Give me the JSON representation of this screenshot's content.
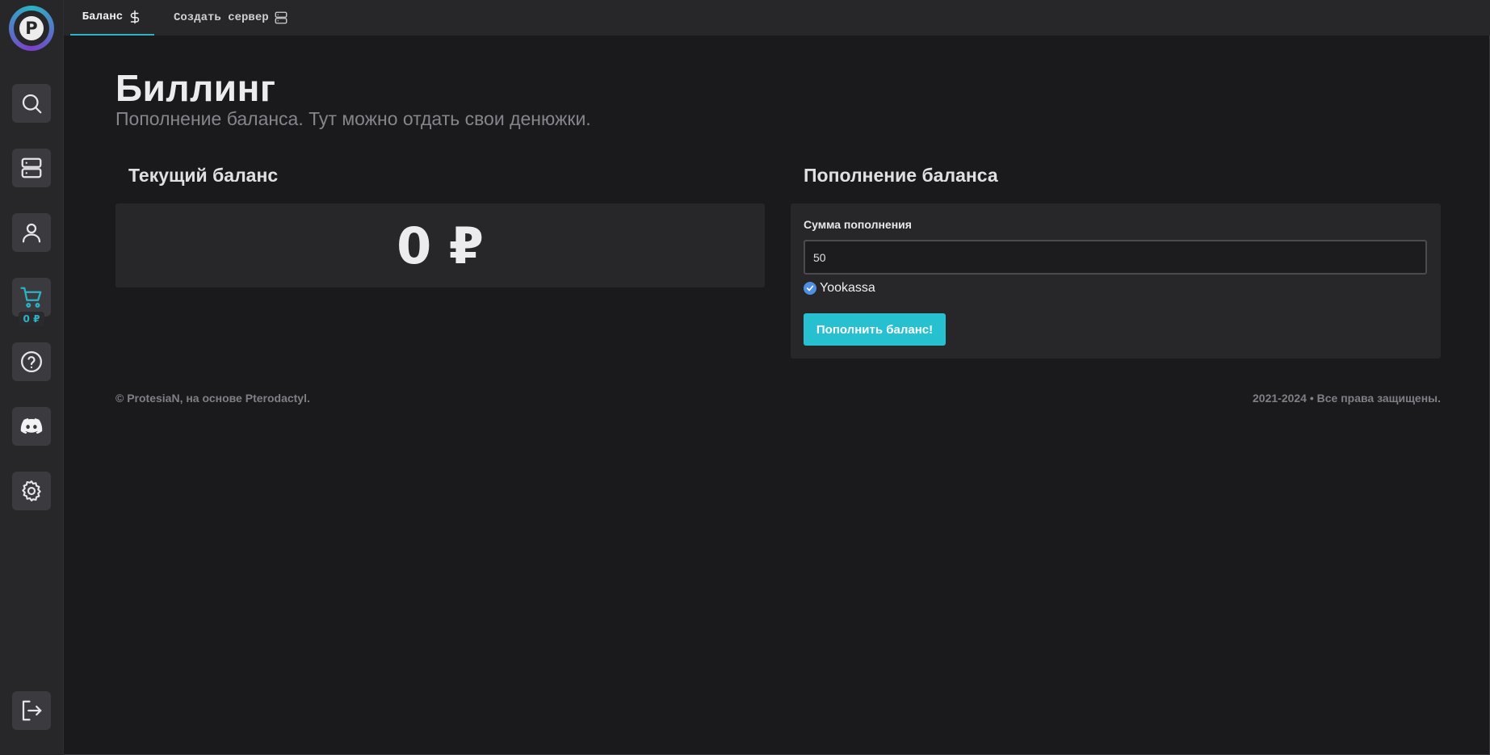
{
  "sidebar": {
    "logo_letter": "P",
    "cart_balance": "0 ₽",
    "items": [
      {
        "icon": "search-icon"
      },
      {
        "icon": "servers-icon"
      },
      {
        "icon": "user-icon"
      },
      {
        "icon": "cart-icon"
      },
      {
        "icon": "help-icon"
      },
      {
        "icon": "discord-icon"
      },
      {
        "icon": "gear-icon"
      },
      {
        "icon": "logout-icon"
      }
    ]
  },
  "topbar": {
    "tabs": [
      {
        "label": "Баланс",
        "icon": "dollar-icon",
        "active": true
      },
      {
        "label": "Создать сервер",
        "icon": "server-icon",
        "active": false
      }
    ]
  },
  "page": {
    "title": "Биллинг",
    "subtitle": "Пополнение баланса. Тут можно отдать свои денюжки."
  },
  "current_balance": {
    "title": "Текущий баланс",
    "value": "0 ₽"
  },
  "topup": {
    "title": "Пополнение баланса",
    "amount_label": "Сумма пополнения",
    "amount_value": "50",
    "payment_method": "Yookassa",
    "submit_label": "Пополнить баланс!"
  },
  "footer": {
    "left": "© ProtesiaN, на основе Pterodactyl.",
    "right": "2021-2024 • Все права защищены."
  },
  "colors": {
    "accent": "#26c0d0",
    "background": "#1a1a1c",
    "panel": "#27272a",
    "radio": "#4f8fe3"
  }
}
